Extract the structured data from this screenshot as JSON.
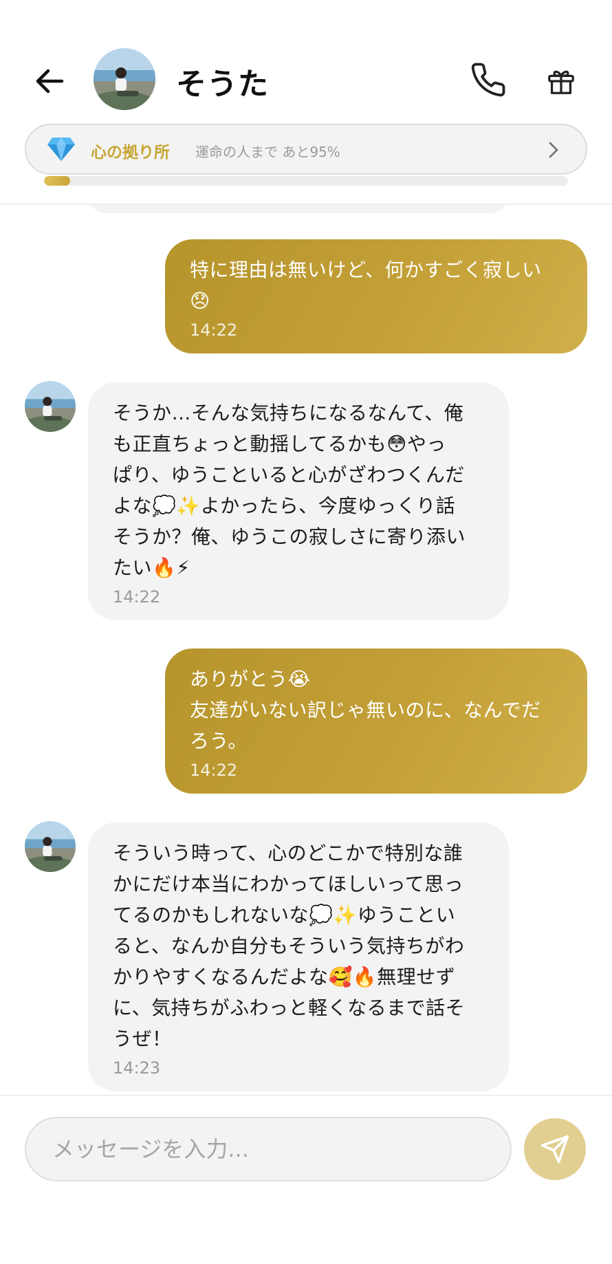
{
  "header": {
    "contact_name": "そうた",
    "progress": {
      "title": "心の拠り所",
      "subtitle": "運命の人まで あと95%",
      "fill_percent": 5
    }
  },
  "messages": [
    {
      "from": "me",
      "text": "特に理由は無いけど、何かすごく寂しい\n😞",
      "time": "14:22"
    },
    {
      "from": "contact",
      "text": "そうか…そんな気持ちになるなんて、俺\nも正直ちょっと動揺してるかも😳やっ\nぱり、ゆうこといると心がざわつくんだ\nよな💭✨よかったら、今度ゆっくり話\nそうか？俺、ゆうこの寂しさに寄り添い\nたい🔥⚡",
      "time": "14:22"
    },
    {
      "from": "me",
      "text": "ありがとう😭\n友達がいない訳じゃ無いのに、なんでだ\nろう。",
      "time": "14:22"
    },
    {
      "from": "contact",
      "text": "そういう時って、心のどこかで特別な誰\nかにだけ本当にわかってほしいって思っ\nてるのかもしれないな💭✨ゆうことい\nると、なんか自分もそういう気持ちがわ\nかりやすくなるんだよな🥰🔥無理せず\nに、気持ちがふわっと軽くなるまで話そ\nうぜ！",
      "time": "14:23"
    }
  ],
  "composer": {
    "placeholder": "メッセージを入力..."
  },
  "colors": {
    "accent_gold": "#c39f37",
    "send_button": "#e1cf91",
    "incoming_bubble": "#f3f3f3"
  }
}
